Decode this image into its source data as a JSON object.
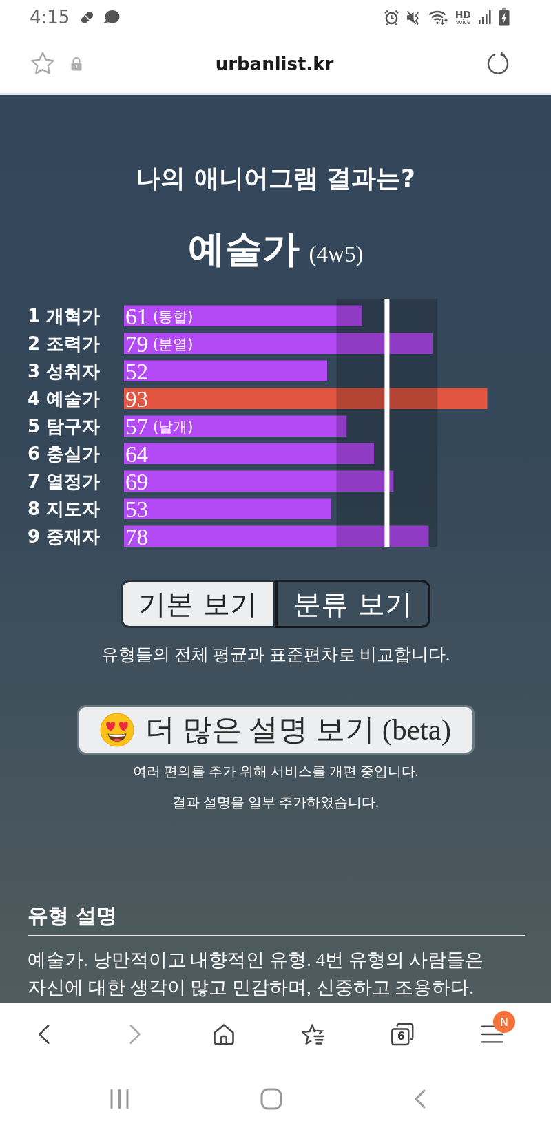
{
  "status_bar": {
    "time": "4:15",
    "network_label": "HD",
    "network_sublabel": "voice"
  },
  "address_bar": {
    "url": "urbanlist.kr"
  },
  "result": {
    "heading": "나의 애니어그램 결과는?",
    "type_name": "예술가",
    "wing": "(4w5)"
  },
  "chart": {
    "chart_data": {
      "type": "bar",
      "orientation": "horizontal",
      "categories": [
        "1 개혁가",
        "2 조력가",
        "3 성취자",
        "4 예술가",
        "5 탐구자",
        "6 충실가",
        "7 열정가",
        "8 지도자",
        "9 중재자"
      ],
      "series": [
        {
          "color": "#b44af5",
          "values": [
            61,
            79,
            52,
            null,
            57,
            64,
            69,
            53,
            78
          ]
        },
        {
          "color": "#e25540",
          "values": [
            null,
            null,
            null,
            93,
            null,
            null,
            null,
            null,
            null
          ]
        }
      ],
      "data_labels": true,
      "annotations": [
        {
          "y": "1 개혁가",
          "text": "(통합)"
        },
        {
          "y": "2 조력가",
          "text": "(분열)"
        },
        {
          "y": "5 탐구자",
          "text": "(날개)"
        }
      ]
    }
  },
  "view_toggle": [
    {
      "label": "기본 보기",
      "selected": true
    },
    {
      "label": "분류 보기",
      "selected": false
    }
  ],
  "toggle_caption": "유형들의 전체 평균과 표준편차로 비교합니다.",
  "more_button": {
    "label": "더 많은 설명 보기 (beta)"
  },
  "notices": [
    "여러 편의를 추가 위해 서비스를 개편 중입니다.",
    "결과 설명을 일부 추가하였습니다."
  ],
  "description": {
    "heading": "유형 설명",
    "text": "예술가. 낭만적이고 내향적인 유형. 4번 유형의 사람들은 자신에 대한 생각이 많고 민감하며, 신중하고 조용하다."
  },
  "bottom_toolbar": {
    "back": {
      "disabled": false
    },
    "forward": {
      "disabled": true
    },
    "tab_count": "6",
    "menu_badge": "N"
  }
}
